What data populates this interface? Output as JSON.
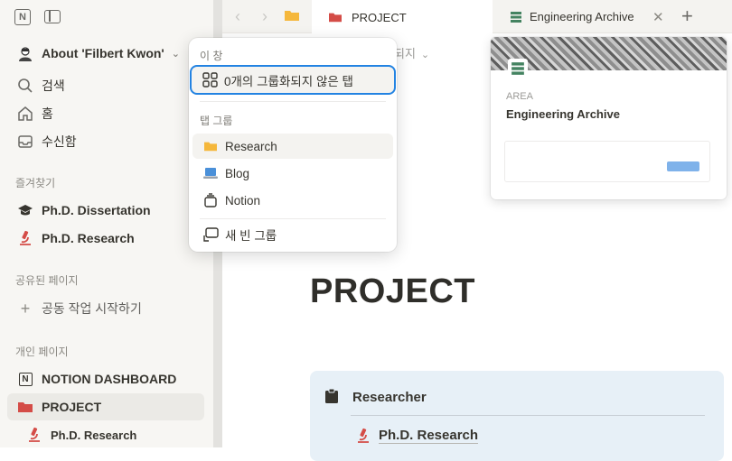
{
  "sidebar": {
    "workspace_name": "About 'Filbert Kwon'",
    "nav": [
      {
        "label": "검색",
        "icon": "search-icon"
      },
      {
        "label": "홈",
        "icon": "home-icon"
      },
      {
        "label": "수신함",
        "icon": "inbox-icon"
      }
    ],
    "favorites_label": "즐겨찾기",
    "favorites": [
      {
        "label": "Ph.D. Dissertation",
        "icon": "graduation-cap-icon"
      },
      {
        "label": "Ph.D. Research",
        "icon": "microscope-icon"
      }
    ],
    "shared_label": "공유된 페이지",
    "shared_action": "공동 작업 시작하기",
    "private_label": "개인 페이지",
    "private": [
      {
        "label": "NOTION DASHBOARD",
        "icon": "notion-icon"
      },
      {
        "label": "PROJECT",
        "icon": "folder-icon"
      },
      {
        "label": "Ph.D. Research",
        "icon": "microscope-icon"
      }
    ]
  },
  "tabs": {
    "active": "PROJECT",
    "second": "Engineering Archive"
  },
  "behind_text": "되지",
  "popup": {
    "this_window_label": "이 창",
    "ungrouped": "0개의 그룹화되지 않은 탭",
    "groups_label": "탭 그룹",
    "groups": [
      {
        "label": "Research",
        "icon": "folder-icon"
      },
      {
        "label": "Blog",
        "icon": "laptop-icon"
      },
      {
        "label": "Notion",
        "icon": "notion-stack-icon"
      }
    ],
    "new_group": "새 빈 그룹"
  },
  "preview": {
    "kind": "AREA",
    "title": "Engineering Archive"
  },
  "page": {
    "title": "PROJECT",
    "callout_title": "Researcher",
    "callout_link": "Ph.D. Research"
  },
  "colors": {
    "accent_blue": "#2383e2",
    "folder_red": "#d44c47",
    "folder_yellow": "#f5b73b",
    "callout_bg": "#e7f0f7"
  }
}
